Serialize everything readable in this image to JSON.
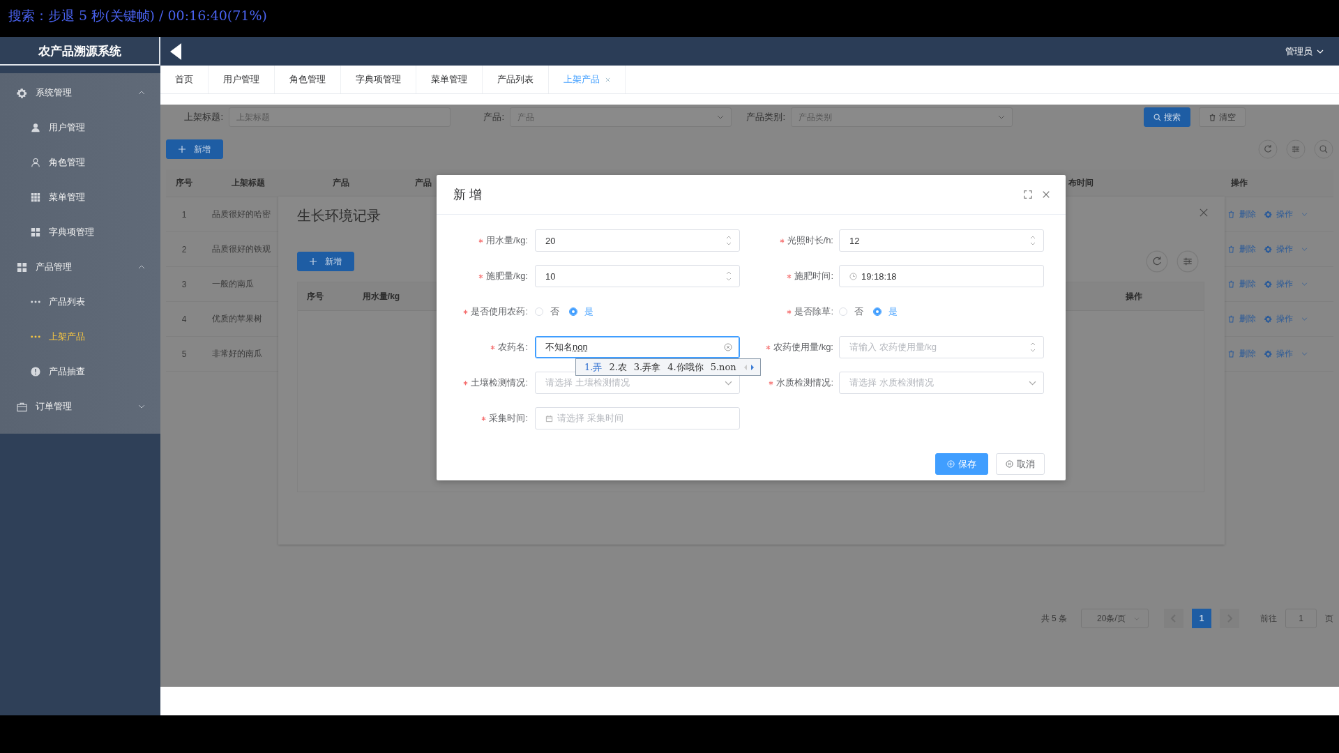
{
  "player_osd": {
    "text": "搜索：步退 5 秒(关键帧) / 00:16:40(71%)"
  },
  "sidebar": {
    "title": "农产品溯源系统",
    "groups": [
      {
        "label": "系统管理",
        "expanded": true,
        "children": [
          {
            "label": "用户管理",
            "selected": false
          },
          {
            "label": "角色管理",
            "selected": false
          },
          {
            "label": "菜单管理",
            "selected": false
          },
          {
            "label": "字典项管理",
            "selected": false
          }
        ]
      },
      {
        "label": "产品管理",
        "expanded": true,
        "children": [
          {
            "label": "产品列表",
            "selected": false
          },
          {
            "label": "上架产品",
            "selected": true
          },
          {
            "label": "产品抽查",
            "selected": false
          }
        ]
      },
      {
        "label": "订单管理",
        "expanded": false
      }
    ]
  },
  "header": {
    "user": "管理员"
  },
  "tabs": [
    {
      "label": "首页",
      "selected": false,
      "closable": false
    },
    {
      "label": "用户管理",
      "selected": false,
      "closable": false
    },
    {
      "label": "角色管理",
      "selected": false,
      "closable": false
    },
    {
      "label": "字典项管理",
      "selected": false,
      "closable": false
    },
    {
      "label": "菜单管理",
      "selected": false,
      "closable": false
    },
    {
      "label": "产品列表",
      "selected": false,
      "closable": false
    },
    {
      "label": "上架产品",
      "selected": true,
      "closable": true
    }
  ],
  "filters": [
    {
      "label": "上架标题:",
      "placeholder": "上架标题",
      "kind": "input"
    },
    {
      "label": "产品:",
      "placeholder": "产品",
      "kind": "select"
    },
    {
      "label": "产品类别:",
      "placeholder": "产品类别",
      "kind": "select"
    }
  ],
  "filter_buttons": [
    {
      "label": "搜索",
      "kind": "primary"
    },
    {
      "label": "清空",
      "kind": "plain"
    }
  ],
  "add_button": "新增",
  "table": {
    "columns": [
      "序号",
      "上架标题",
      "产品",
      "产品",
      "布时间",
      "操作"
    ],
    "rows": [
      {
        "index": "1",
        "title": "品质很好的哈密",
        "delete": "删除",
        "more": "操作"
      },
      {
        "index": "2",
        "title": "品质很好的铁观",
        "delete": "删除",
        "more": "操作"
      },
      {
        "index": "3",
        "title": "一般的南瓜",
        "delete": "删除",
        "more": "操作"
      },
      {
        "index": "4",
        "title": "优质的苹果树",
        "delete": "删除",
        "more": "操作"
      },
      {
        "index": "5",
        "title": "非常好的南瓜",
        "delete": "删除",
        "more": "操作"
      }
    ]
  },
  "pagination": {
    "total": "共 5 条",
    "page_size": "20条/页",
    "pages": [
      {
        "label": "1",
        "selected": true
      }
    ],
    "goto_label": "前往",
    "goto_value": "1",
    "goto_suffix": "页"
  },
  "record_panel": {
    "title": "生长环境记录",
    "add_button": "新增",
    "columns": [
      "序号",
      "用水量/kg",
      "操作"
    ]
  },
  "dialog": {
    "title": "新 增",
    "fields": [
      {
        "label": "用水量/kg:",
        "kind": "number",
        "value": "20",
        "required": true,
        "focused": false
      },
      {
        "label": "光照时长/h:",
        "kind": "number",
        "value": "12",
        "required": true,
        "focused": false
      },
      {
        "label": "施肥量/kg:",
        "kind": "number",
        "value": "10",
        "required": true,
        "focused": false
      },
      {
        "label": "施肥时间:",
        "kind": "time",
        "value": "19:18:18",
        "required": true,
        "focused": false
      },
      {
        "label": "是否使用农药:",
        "kind": "radio",
        "required": true,
        "options": [
          {
            "label": "否",
            "selected": false
          },
          {
            "label": "是",
            "selected": true
          }
        ]
      },
      {
        "label": "是否除草:",
        "kind": "radio",
        "required": true,
        "options": [
          {
            "label": "否",
            "selected": false
          },
          {
            "label": "是",
            "selected": true
          }
        ]
      },
      {
        "label": "农药名:",
        "kind": "text",
        "value": "不知名",
        "composition": "non",
        "required": true,
        "focused": true
      },
      {
        "label": "农药使用量/kg:",
        "kind": "number",
        "placeholder": "请输入 农药使用量/kg",
        "required": true,
        "focused": false
      },
      {
        "label": "土壤检测情况:",
        "kind": "select",
        "placeholder": "请选择 土壤检测情况",
        "required": true,
        "focused": false
      },
      {
        "label": "水质检测情况:",
        "kind": "select",
        "placeholder": "请选择 水质检测情况",
        "required": true,
        "focused": false
      },
      {
        "label": "采集时间:",
        "kind": "date",
        "placeholder": "请选择 采集时间",
        "required": true,
        "focused": false
      }
    ],
    "buttons": [
      {
        "label": "保存",
        "kind": "primary"
      },
      {
        "label": "取消",
        "kind": "plain"
      }
    ]
  },
  "ime": {
    "candidates": [
      {
        "label": "1.弄",
        "selected": true
      },
      {
        "label": "2.农",
        "selected": false
      },
      {
        "label": "3.弄拿",
        "selected": false
      },
      {
        "label": "4.你哦你",
        "selected": false
      },
      {
        "label": "5.non",
        "selected": false
      }
    ]
  }
}
